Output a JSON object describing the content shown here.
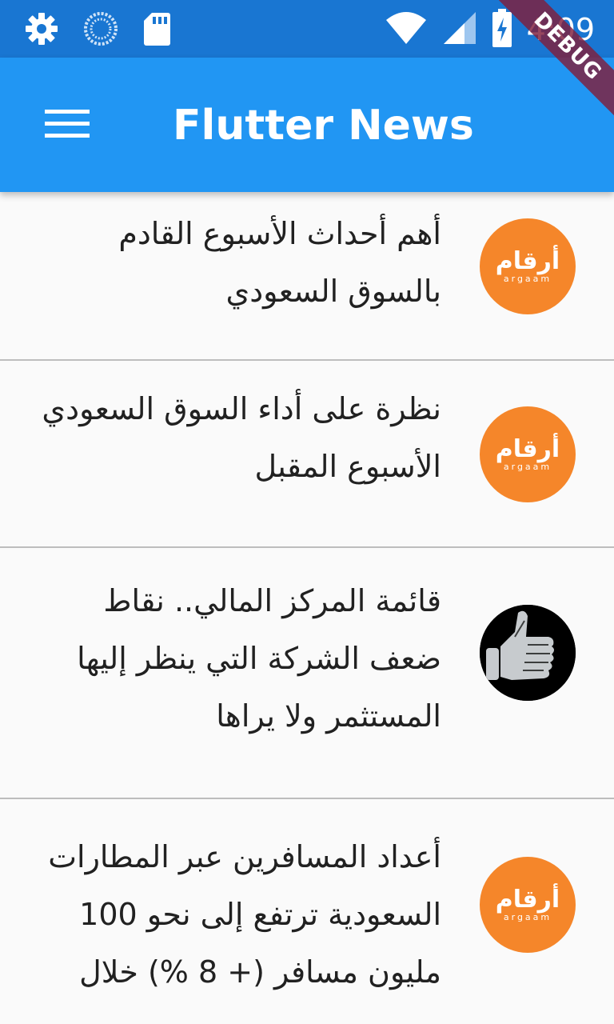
{
  "status_bar": {
    "time": "4:09",
    "icons": [
      "settings-icon",
      "sync-icon",
      "sd-card-icon",
      "wifi-icon",
      "cell-signal-icon",
      "battery-charging-icon"
    ]
  },
  "app_bar": {
    "title": "Flutter News",
    "menu_icon": "menu-icon"
  },
  "debug_banner": "DEBUG",
  "news": [
    {
      "title": "أهم أحداث الأسبوع القادم بالسوق السعودي",
      "avatar": "argaam-logo"
    },
    {
      "title": "نظرة على أداء السوق السعودي الأسبوع المقبل",
      "avatar": "argaam-logo"
    },
    {
      "title": "قائمة المركز المالي.. نقاط ضعف الشركة التي ينظر إليها المستثمر ولا يراها",
      "avatar": "thumbs-up-xray-image"
    },
    {
      "title": "أعداد المسافرين عبر المطارات السعودية ترتفع إلى نحو 100 مليون مسافر (+ 8 %) خلال",
      "avatar": "argaam-logo"
    }
  ],
  "argaam_logo": {
    "arabic": "أرقام",
    "latin": "argaam"
  },
  "colors": {
    "status_bar": "#1976d2",
    "app_bar": "#2196f3",
    "argaam_orange": "#f5862a",
    "divider": "#bdbdbd",
    "background": "#fafafa"
  }
}
